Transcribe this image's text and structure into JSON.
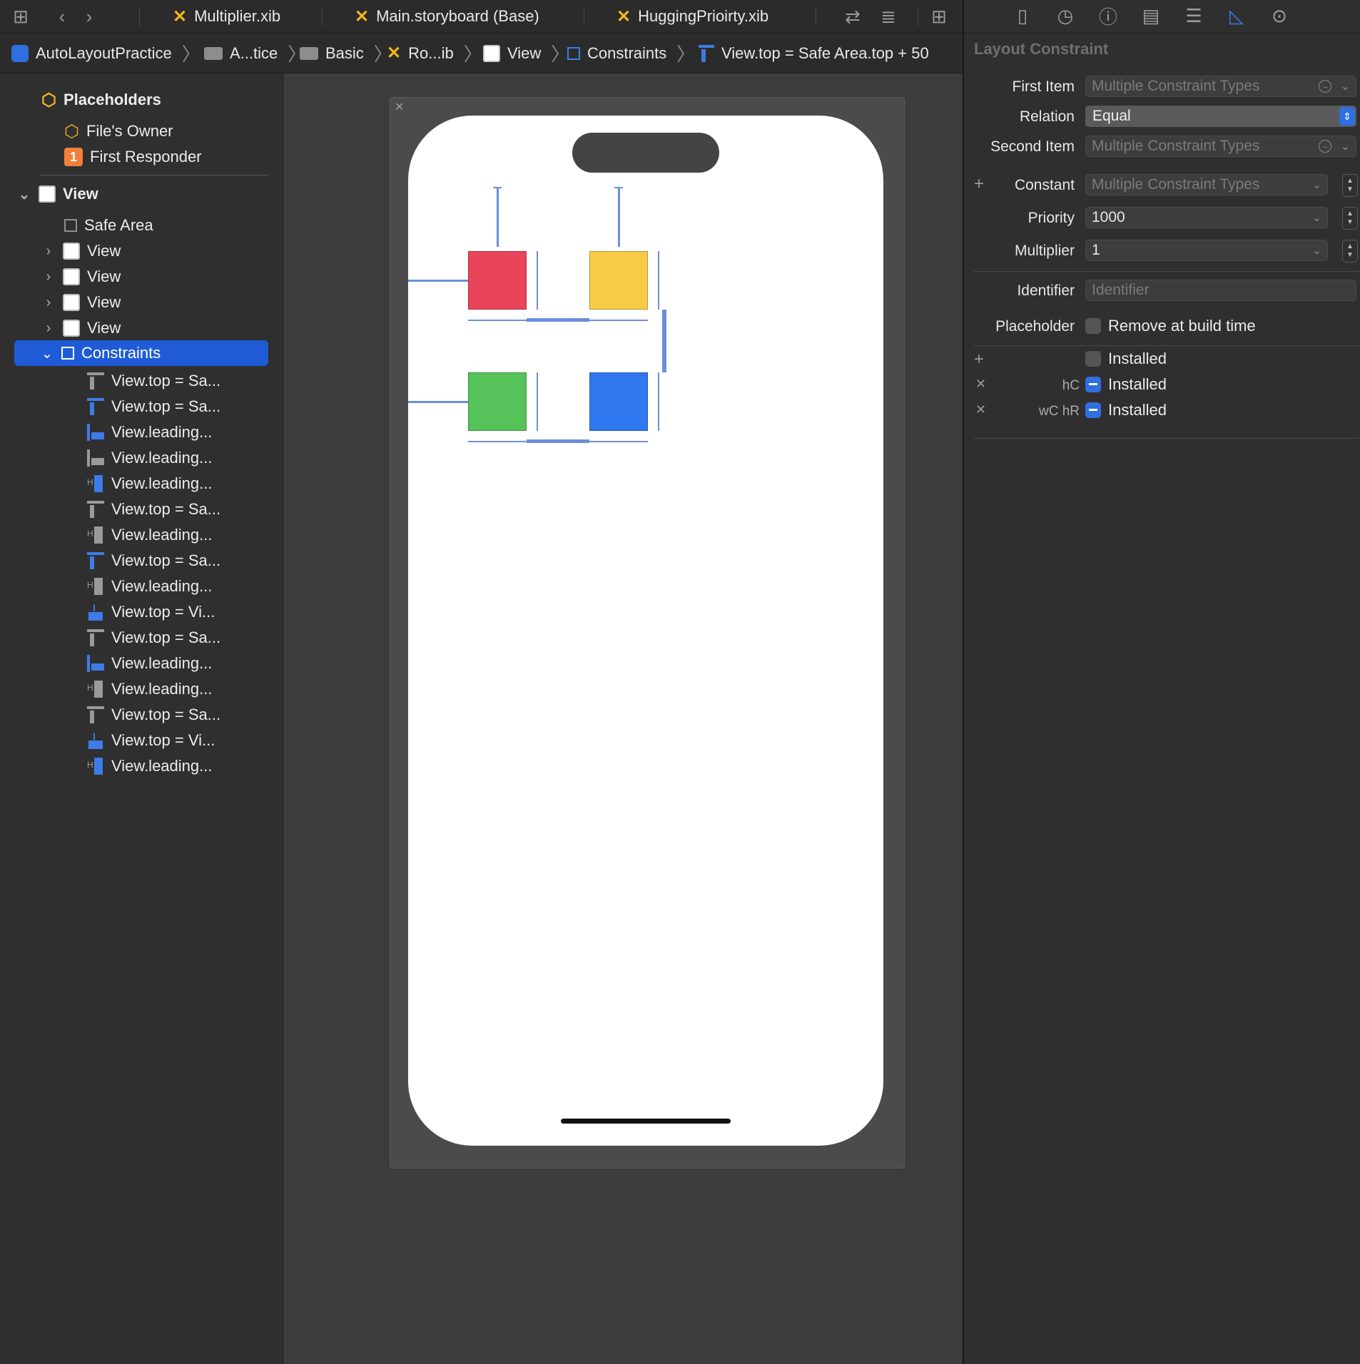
{
  "tabs": [
    {
      "label": "Multiplier.xib"
    },
    {
      "label": "Main.storyboard (Base)"
    },
    {
      "label": "HuggingPrioirty.xib"
    }
  ],
  "breadcrumb": [
    "AutoLayoutPractice",
    "A...tice",
    "Basic",
    "Ro...ib",
    "View",
    "Constraints",
    "View.top = Safe Area.top + 50"
  ],
  "outline": {
    "placeholders": "Placeholders",
    "files_owner": "File's Owner",
    "first_responder": "First Responder",
    "first_responder_badge": "1",
    "view": "View",
    "safe_area": "Safe Area",
    "subviews": [
      "View",
      "View",
      "View",
      "View"
    ],
    "constraints_label": "Constraints",
    "constraints": [
      {
        "label": "View.top = Sa...",
        "icon": "top-gray"
      },
      {
        "label": "View.top = Sa...",
        "icon": "top-blue"
      },
      {
        "label": "View.leading...",
        "icon": "leading-blue"
      },
      {
        "label": "View.leading...",
        "icon": "leading-gray"
      },
      {
        "label": "View.leading...",
        "icon": "spacing-blue"
      },
      {
        "label": "View.top = Sa...",
        "icon": "top-gray"
      },
      {
        "label": "View.leading...",
        "icon": "spacing-gray"
      },
      {
        "label": "View.top = Sa...",
        "icon": "top-blue"
      },
      {
        "label": "View.leading...",
        "icon": "spacing-gray"
      },
      {
        "label": "View.top = Vi...",
        "icon": "vertical-blue"
      },
      {
        "label": "View.top = Sa...",
        "icon": "top-gray"
      },
      {
        "label": "View.leading...",
        "icon": "leading-blue"
      },
      {
        "label": "View.leading...",
        "icon": "spacing-gray"
      },
      {
        "label": "View.top = Sa...",
        "icon": "top-gray"
      },
      {
        "label": "View.top = Vi...",
        "icon": "vertical-blue"
      },
      {
        "label": "View.leading...",
        "icon": "spacing-blue"
      }
    ]
  },
  "canvas": {
    "box_colors": {
      "red": "#e8445a",
      "yellow": "#f8cb46",
      "green": "#55c25a",
      "blue": "#2f78ef"
    }
  },
  "inspector": {
    "section_title": "Layout Constraint",
    "first_item_label": "First Item",
    "first_item_value": "Multiple Constraint Types",
    "relation_label": "Relation",
    "relation_value": "Equal",
    "second_item_label": "Second Item",
    "second_item_value": "Multiple Constraint Types",
    "constant_label": "Constant",
    "constant_value": "Multiple Constraint Types",
    "priority_label": "Priority",
    "priority_value": "1000",
    "multiplier_label": "Multiplier",
    "multiplier_value": "1",
    "identifier_label": "Identifier",
    "identifier_placeholder": "Identifier",
    "placeholder_label": "Placeholder",
    "remove_at_build": "Remove at build time",
    "installed_rows": [
      {
        "variation": "",
        "label": "Installed",
        "checked": false
      },
      {
        "variation": "hC",
        "label": "Installed",
        "checked": true
      },
      {
        "variation": "wC hR",
        "label": "Installed",
        "checked": true
      }
    ]
  },
  "accent_color": "#1f5bd6"
}
